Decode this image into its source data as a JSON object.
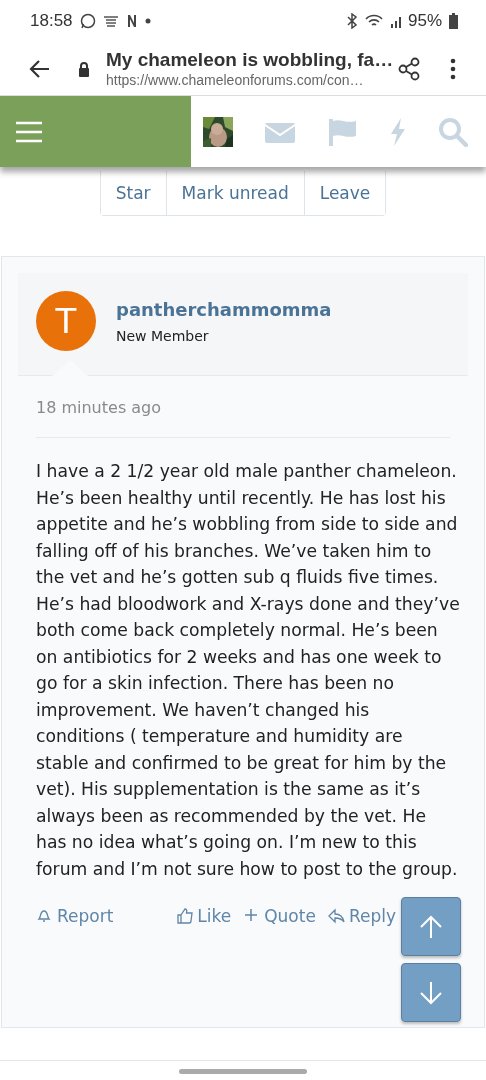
{
  "status_bar": {
    "time": "18:58",
    "battery": "95%"
  },
  "browser": {
    "title": "My chameleon is wobbling, fa…",
    "url": "https://www.chameleonforums.com/con…"
  },
  "thread_actions": [
    "Star",
    "Mark unread",
    "Leave"
  ],
  "post": {
    "avatar_letter": "T",
    "author": "pantherchammomma",
    "role": "New Member",
    "time": "18 minutes ago",
    "body": "I have a 2 1/2 year old male panther chameleon. He’s been healthy until recently. He has lost his appetite and he’s wobbling from side to side and falling off of his branches. We’ve taken him to the vet and he’s gotten sub q fluids five times. He’s had bloodwork and X-rays done and they’ve both come back completely normal. He’s been on antibiotics for 2 weeks and has one week to go for a skin infection. There has been no improvement. We haven’t changed his conditions ( temperature and humidity are stable and confirmed to be great for him by the vet). His supplementation is the same as it’s always been as recommended by the vet. He has no idea what’s going on. I’m new to this forum and I’m not sure how to post to the group.",
    "actions": [
      {
        "kind": "report",
        "label": "Report"
      },
      {
        "kind": "like",
        "label": "Like"
      },
      {
        "kind": "quote",
        "label": "Quote"
      },
      {
        "kind": "reply",
        "label": "Reply"
      }
    ]
  }
}
